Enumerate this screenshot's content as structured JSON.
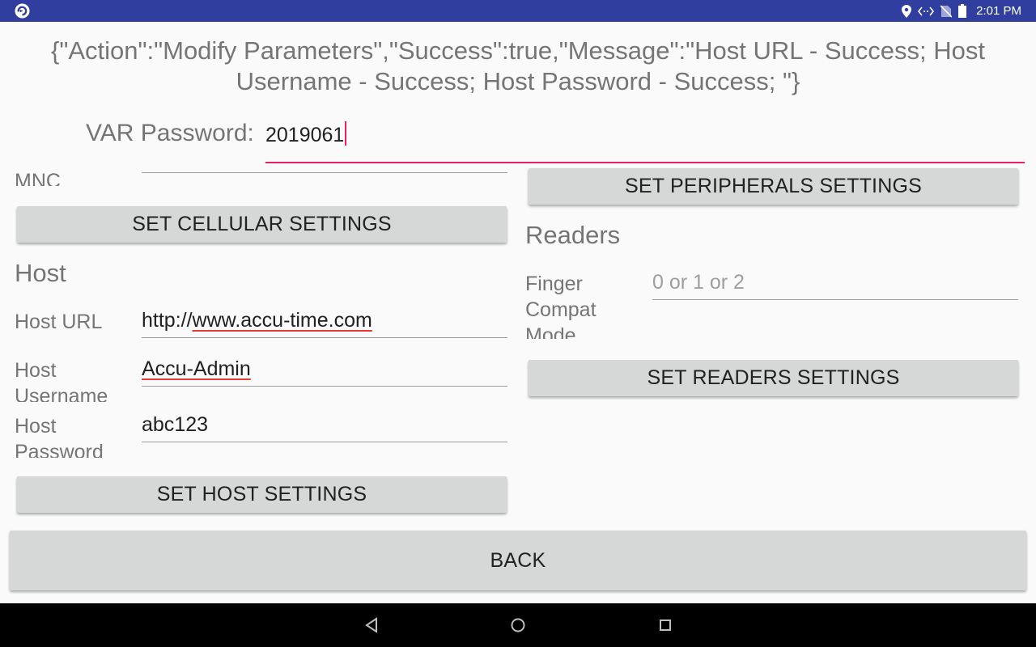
{
  "status_bar": {
    "time": "2:01 PM",
    "icons": [
      "app-logo-icon",
      "location-icon",
      "data-transfer-icon",
      "no-sim-icon",
      "battery-icon"
    ]
  },
  "response_message": "{\"Action\":\"Modify Parameters\",\"Success\":true,\"Message\":\"Host URL - Success; Host Username - Success; Host Password - Success; \"}",
  "var_password": {
    "label": "VAR Password:",
    "value": "2019061"
  },
  "cellular": {
    "mnc_label": "MNC",
    "button_label": "SET CELLULAR SETTINGS"
  },
  "host": {
    "title": "Host",
    "url_label": "Host URL",
    "url_prefix": "http://",
    "url_main": "www.accu-time.com",
    "username_label": "Host Username",
    "username_value": "Accu-Admin",
    "password_label": "Host Password",
    "password_value": "abc123",
    "button_label": "SET HOST SETTINGS"
  },
  "peripherals": {
    "button_label": "SET PERIPHERALS SETTINGS"
  },
  "readers": {
    "title": "Readers",
    "finger_label": "Finger Compat Mode",
    "finger_placeholder": "0 or 1 or 2",
    "button_label": "SET READERS SETTINGS"
  },
  "back_label": "BACK",
  "nav": {
    "icons": [
      "back-icon",
      "home-icon",
      "recents-icon"
    ]
  },
  "colors": {
    "status_bar": "#303f9f",
    "accent": "#e91e63",
    "button": "#d6d7d7"
  }
}
